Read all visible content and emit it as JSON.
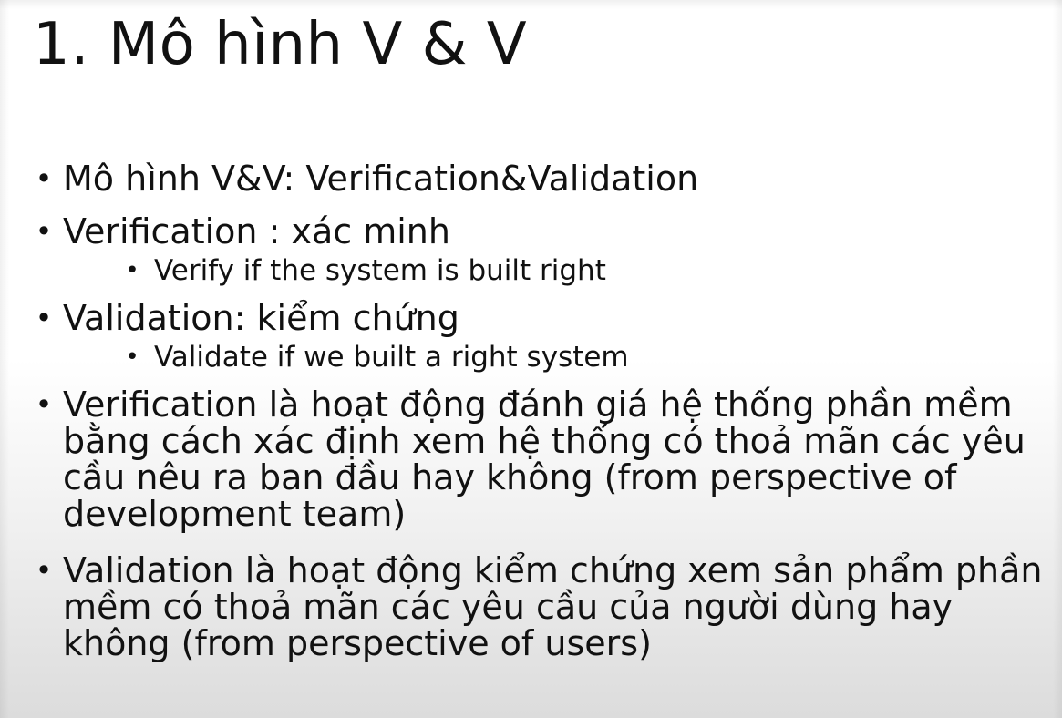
{
  "slide": {
    "title": "1. Mô hình V & V",
    "bullets": [
      {
        "text": "Mô hình V&V: Verification&Validation"
      },
      {
        "text": "Verification : xác minh",
        "sub": "Verify if the system is built right"
      },
      {
        "text": "Validation: kiểm chứng",
        "sub": "Validate if we built a right system"
      },
      {
        "text": "Verification là hoạt động đánh giá hệ thống phần mềm bằng cách xác định xem hệ thống có thoả mãn các yêu cầu nêu ra ban đầu hay không (from perspective of development team)"
      },
      {
        "text": "Validation là hoạt động kiểm chứng xem sản phẩm phần mềm có thoả mãn các yêu cầu của người dùng hay không (from perspective of users)"
      }
    ],
    "bullet_glyph": "•"
  }
}
